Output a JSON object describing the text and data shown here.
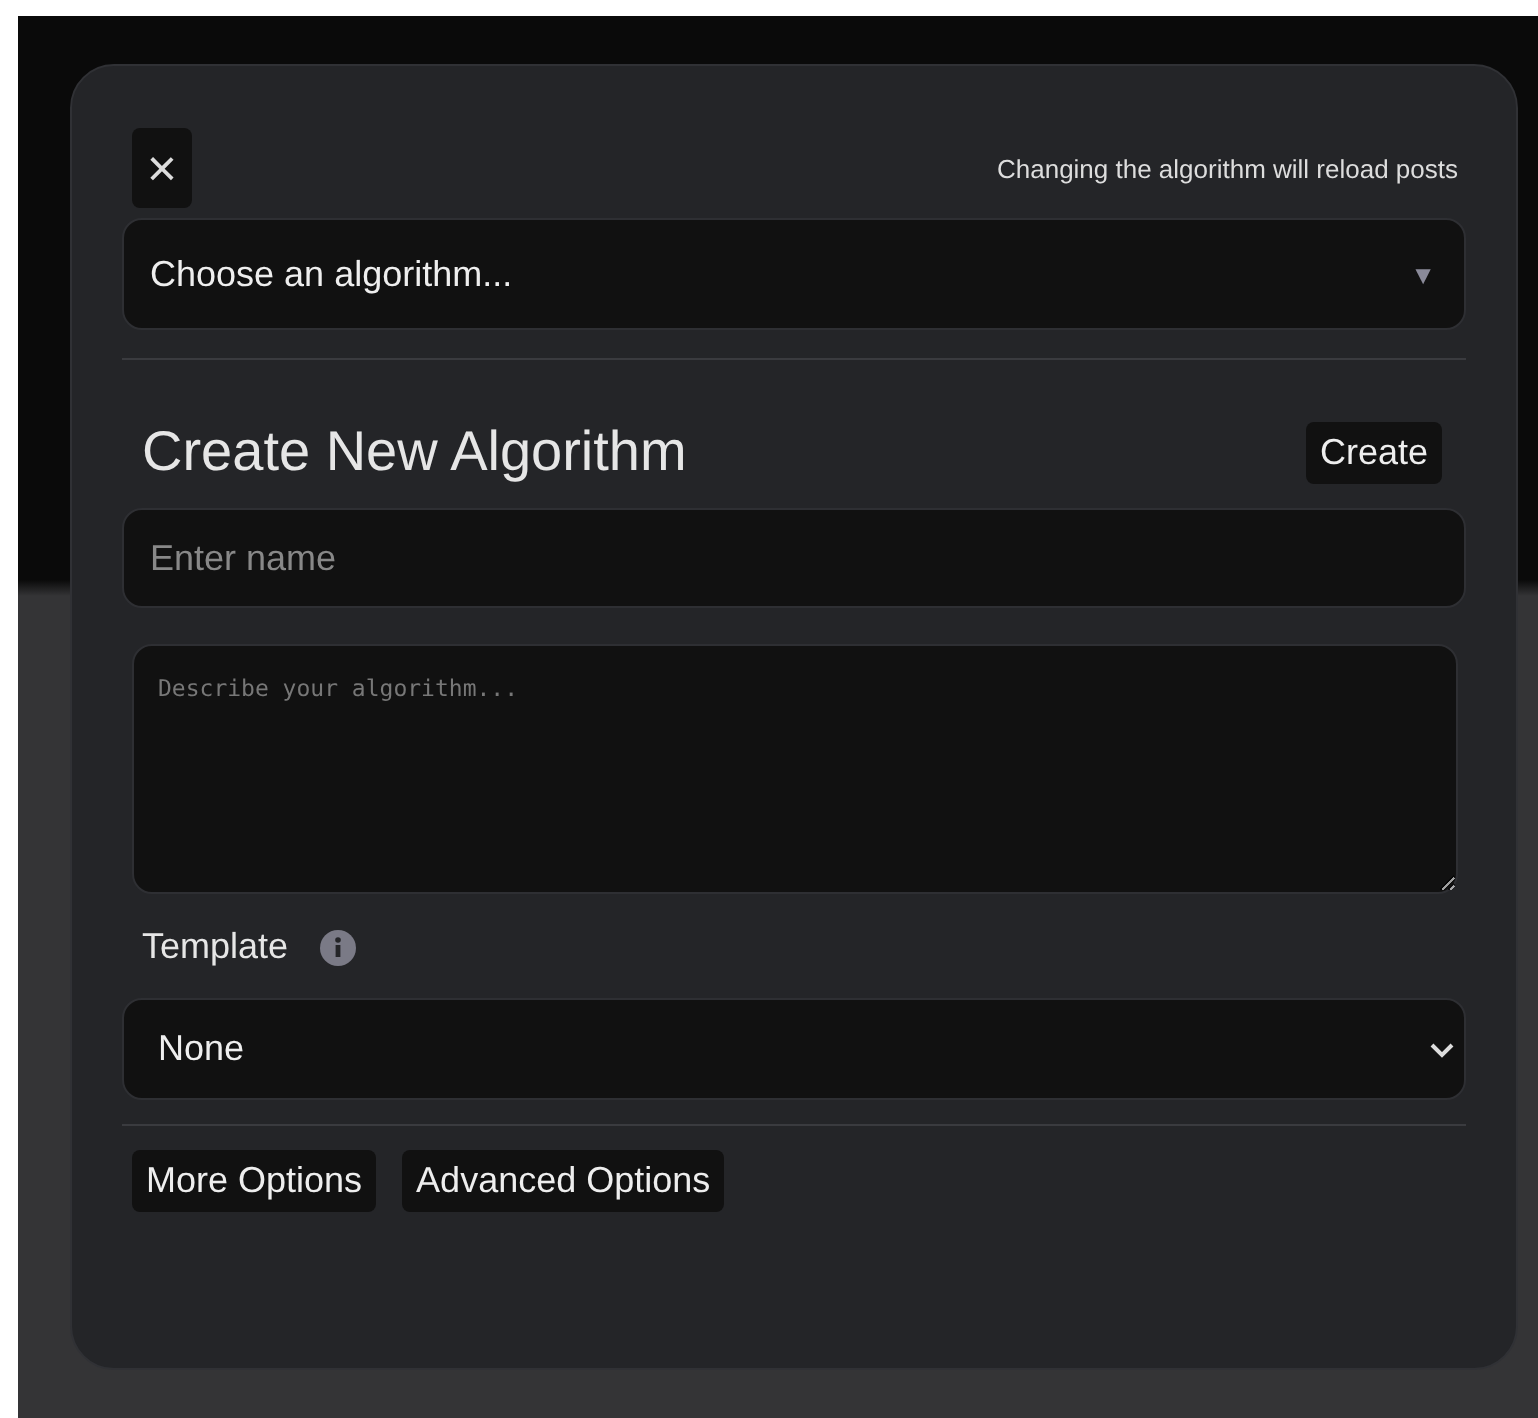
{
  "dialog": {
    "close_label": "×",
    "note": "Changing the algorithm will reload posts",
    "algorithm_select": {
      "value": "Choose an algorithm...",
      "caret": "▼"
    },
    "create_section": {
      "title": "Create New Algorithm",
      "create_button": "Create",
      "name_field": {
        "placeholder": "Enter name"
      },
      "description_field": {
        "placeholder": "Describe your algorithm..."
      },
      "template": {
        "label": "Template",
        "value": "None"
      }
    },
    "buttons": [
      "More Options",
      "Advanced Options"
    ]
  }
}
